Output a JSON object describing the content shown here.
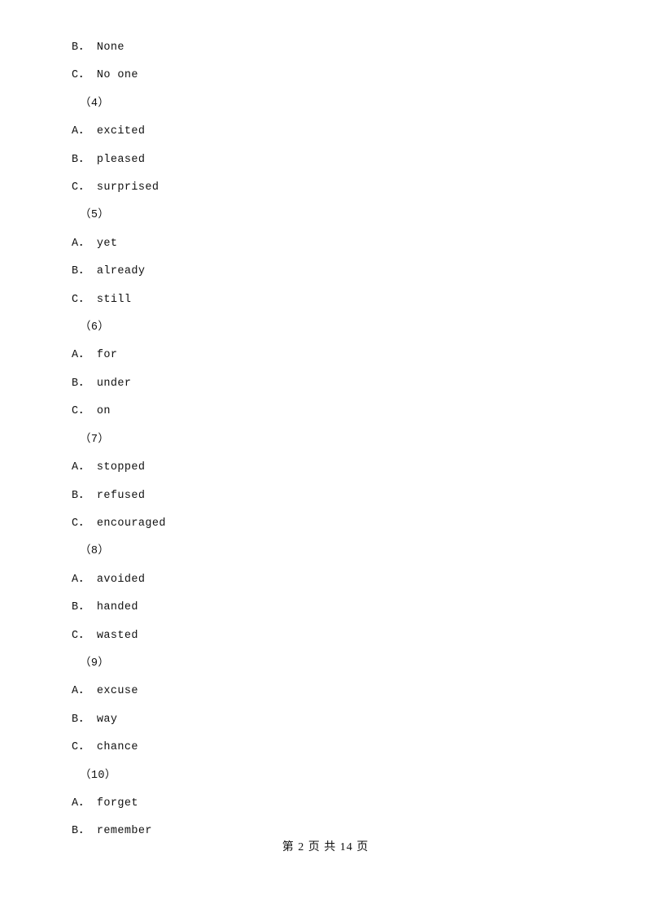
{
  "document": {
    "lines": [
      {
        "kind": "option",
        "text": "B． None"
      },
      {
        "kind": "option",
        "text": "C． No one"
      },
      {
        "kind": "number",
        "text": "（4）"
      },
      {
        "kind": "option",
        "text": "A． excited"
      },
      {
        "kind": "option",
        "text": "B． pleased"
      },
      {
        "kind": "option",
        "text": "C． surprised"
      },
      {
        "kind": "number",
        "text": "（5）"
      },
      {
        "kind": "option",
        "text": "A． yet"
      },
      {
        "kind": "option",
        "text": "B． already"
      },
      {
        "kind": "option",
        "text": "C． still"
      },
      {
        "kind": "number",
        "text": "（6）"
      },
      {
        "kind": "option",
        "text": "A． for"
      },
      {
        "kind": "option",
        "text": "B． under"
      },
      {
        "kind": "option",
        "text": "C． on"
      },
      {
        "kind": "number",
        "text": "（7）"
      },
      {
        "kind": "option",
        "text": "A． stopped"
      },
      {
        "kind": "option",
        "text": "B． refused"
      },
      {
        "kind": "option",
        "text": "C． encouraged"
      },
      {
        "kind": "number",
        "text": "（8）"
      },
      {
        "kind": "option",
        "text": "A． avoided"
      },
      {
        "kind": "option",
        "text": "B． handed"
      },
      {
        "kind": "option",
        "text": "C． wasted"
      },
      {
        "kind": "number",
        "text": "（9）"
      },
      {
        "kind": "option",
        "text": "A． excuse"
      },
      {
        "kind": "option",
        "text": "B． way"
      },
      {
        "kind": "option",
        "text": "C． chance"
      },
      {
        "kind": "number",
        "text": "（10）"
      },
      {
        "kind": "option",
        "text": "A． forget"
      },
      {
        "kind": "option",
        "text": "B． remember"
      }
    ],
    "footer": "第 2 页 共 14 页"
  }
}
